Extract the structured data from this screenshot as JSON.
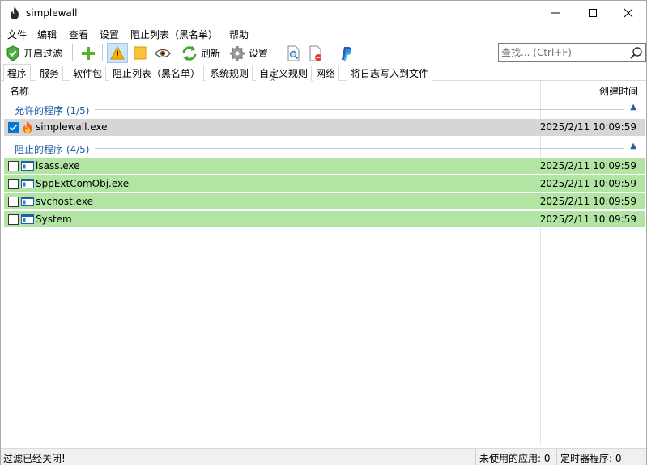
{
  "window": {
    "title": "simplewall",
    "controls": {
      "minimize": "minimize-icon",
      "maximize": "maximize-icon",
      "close": "close-icon"
    }
  },
  "menu": [
    "文件",
    "编辑",
    "查看",
    "设置",
    "阻止列表（黑名单）",
    "帮助"
  ],
  "toolbar": {
    "enable_filter_label": "开启过滤",
    "refresh_label": "刷新",
    "settings_label": "设置",
    "search_placeholder": "查找... (Ctrl+F)"
  },
  "tabs": [
    "程序",
    "服务",
    "软件包",
    "阻止列表（黑名单）",
    "系统规则",
    "自定义规则",
    "网络",
    "将日志写入到文件"
  ],
  "active_tab": 0,
  "columns": {
    "name": "名称",
    "time": "创建时间"
  },
  "groups": {
    "allowed": {
      "title": "允许的程序 (1/5)",
      "items": [
        {
          "name": "simplewall.exe",
          "time": "2025/2/11 10:09:59",
          "checked": true,
          "icon": "flame-icon"
        }
      ]
    },
    "blocked": {
      "title": "阻止的程序 (4/5)",
      "items": [
        {
          "name": "lsass.exe",
          "time": "2025/2/11 10:09:59",
          "checked": false,
          "icon": "window-app-icon"
        },
        {
          "name": "SppExtComObj.exe",
          "time": "2025/2/11 10:09:59",
          "checked": false,
          "icon": "window-app-icon"
        },
        {
          "name": "svchost.exe",
          "time": "2025/2/11 10:09:59",
          "checked": false,
          "icon": "window-app-icon"
        },
        {
          "name": "System",
          "time": "2025/2/11 10:09:59",
          "checked": false,
          "icon": "window-app-icon"
        }
      ]
    }
  },
  "status": {
    "message": "过滤已经关闭!",
    "unused_apps": "未使用的应用: 0",
    "timer_apps": "定时器程序: 0"
  },
  "colors": {
    "blocked_row": "#b2e4a4",
    "allowed_row": "#d6d6d6",
    "group_title": "#1e5fa8",
    "checkbox_checked": "#0078d7"
  }
}
